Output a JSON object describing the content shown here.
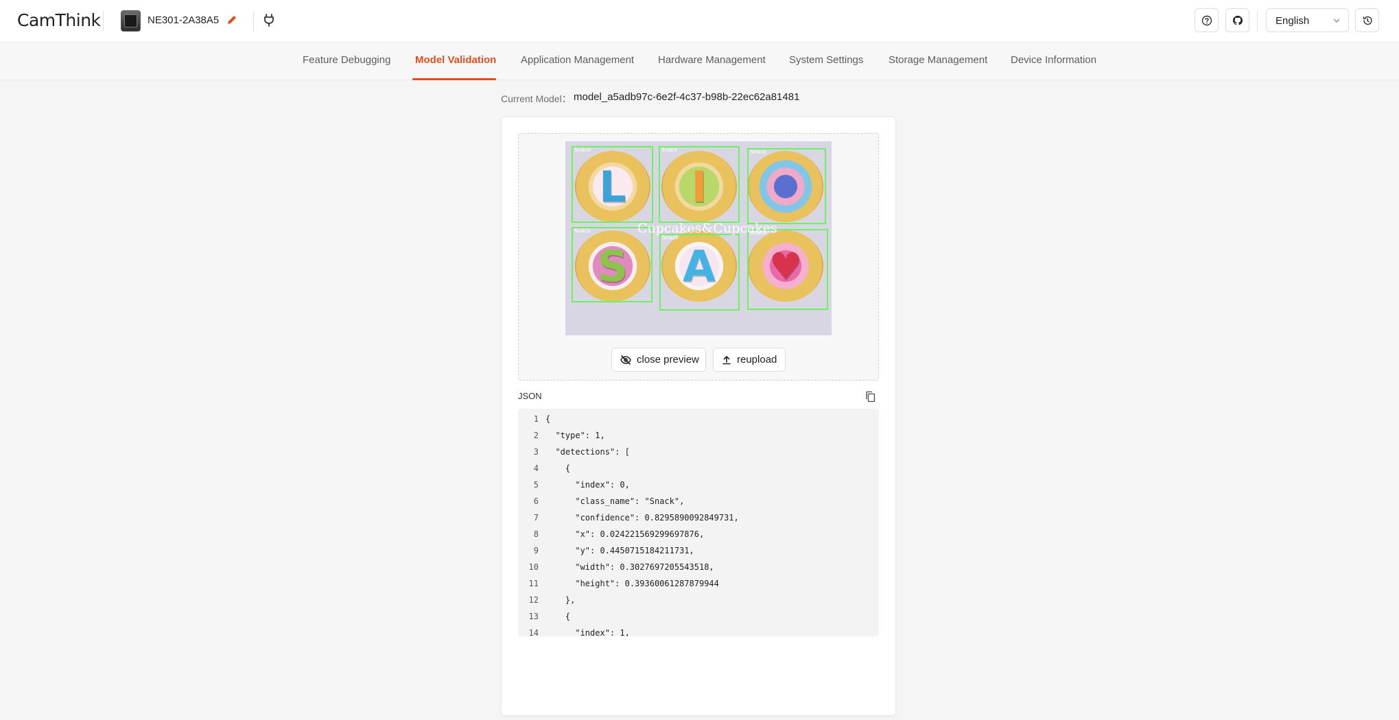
{
  "header": {
    "logo": "CamThink",
    "device_name": "NE301-2A38A5",
    "language": "English"
  },
  "tabs": [
    {
      "label": "Feature Debugging"
    },
    {
      "label": "Model Validation"
    },
    {
      "label": "Application Management"
    },
    {
      "label": "Hardware Management"
    },
    {
      "label": "System Settings"
    },
    {
      "label": "Storage Management"
    },
    {
      "label": "Device Information"
    }
  ],
  "active_tab": "Model Validation",
  "current_model": {
    "label": "Current Model：",
    "value": "model_a5adb97c-6e2f-4c37-b98b-22ec62a81481"
  },
  "preview": {
    "watermark": "Cupcakes&Cupcakes",
    "detections": [
      {
        "label": "Snack",
        "letter": "L",
        "letter_color": "#3aa3d8"
      },
      {
        "label": "Snack",
        "letter": "I",
        "letter_color": "#f09c3a"
      },
      {
        "label": "Snack",
        "letter": "",
        "letter_color": "#5566cc"
      },
      {
        "label": "Snack",
        "letter": "S",
        "letter_color": "#8dc34a"
      },
      {
        "label": "Snack",
        "letter": "A",
        "letter_color": "#43b3e6"
      },
      {
        "label": "Snack",
        "letter": "♥",
        "letter_color": "#d8334d"
      }
    ]
  },
  "buttons": {
    "close_preview": "close preview",
    "reupload": "reupload"
  },
  "json_panel": {
    "title": "JSON",
    "lines": [
      {
        "n": "1",
        "text": "{"
      },
      {
        "n": "2",
        "text": "  \"type\": 1,"
      },
      {
        "n": "3",
        "text": "  \"detections\": ["
      },
      {
        "n": "4",
        "text": "    {"
      },
      {
        "n": "5",
        "text": "      \"index\": 0,"
      },
      {
        "n": "6",
        "text": "      \"class_name\": \"Snack\","
      },
      {
        "n": "7",
        "text": "      \"confidence\": 0.8295890092849731,"
      },
      {
        "n": "8",
        "text": "      \"x\": 0.024221569299697876,"
      },
      {
        "n": "9",
        "text": "      \"y\": 0.4450715184211731,"
      },
      {
        "n": "10",
        "text": "      \"width\": 0.3027697205543518,"
      },
      {
        "n": "11",
        "text": "      \"height\": 0.39360061287879944"
      },
      {
        "n": "12",
        "text": "    },"
      },
      {
        "n": "13",
        "text": "    {"
      },
      {
        "n": "14",
        "text": "      \"index\": 1,"
      }
    ]
  },
  "colors": {
    "accent": "#e0501f",
    "bbox": "#6cf160"
  }
}
